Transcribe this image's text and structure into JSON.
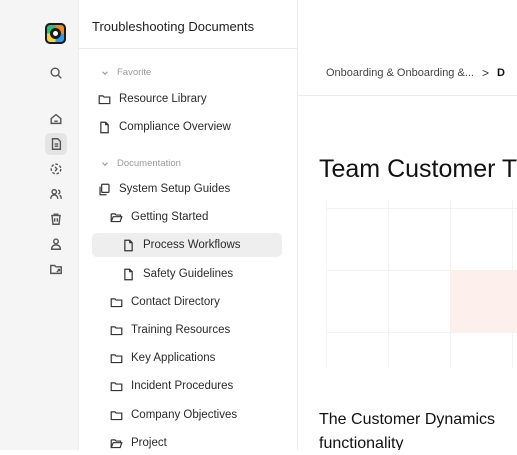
{
  "app": {
    "icons": [
      "app-logo",
      "search-icon",
      "home-icon",
      "document-icon",
      "refresh-icon",
      "users-icon",
      "trash-icon",
      "user-icon",
      "folder-share-icon"
    ]
  },
  "sidebar": {
    "title": "Troubleshooting Documents",
    "sections": {
      "favorite": "Favorite",
      "documentation": "Documentation"
    },
    "favorites": [
      {
        "label": "Resource Library",
        "icon": "folder-icon"
      },
      {
        "label": "Compliance Overview",
        "icon": "file-icon"
      }
    ],
    "docs": [
      {
        "label": "System Setup Guides",
        "icon": "copy-icon"
      },
      {
        "label": "Getting Started",
        "icon": "folder-open-icon"
      },
      {
        "label": "Process Workflows",
        "icon": "file-icon",
        "selected": true
      },
      {
        "label": "Safety Guidelines",
        "icon": "file-icon"
      },
      {
        "label": "Contact Directory",
        "icon": "folder-icon"
      },
      {
        "label": "Training Resources",
        "icon": "folder-icon"
      },
      {
        "label": "Key Applications",
        "icon": "folder-icon"
      },
      {
        "label": "Incident Procedures",
        "icon": "folder-icon"
      },
      {
        "label": "Company Objectives",
        "icon": "folder-icon"
      },
      {
        "label": "Project",
        "icon": "folder-open-icon"
      }
    ]
  },
  "main": {
    "breadcrumb": {
      "part1": "Onboarding & Onboarding &...",
      "sep": ">",
      "part2": "D"
    },
    "title": "Team Customer T",
    "body_line1": "The Customer Dynamics",
    "body_line2": "functionality"
  }
}
